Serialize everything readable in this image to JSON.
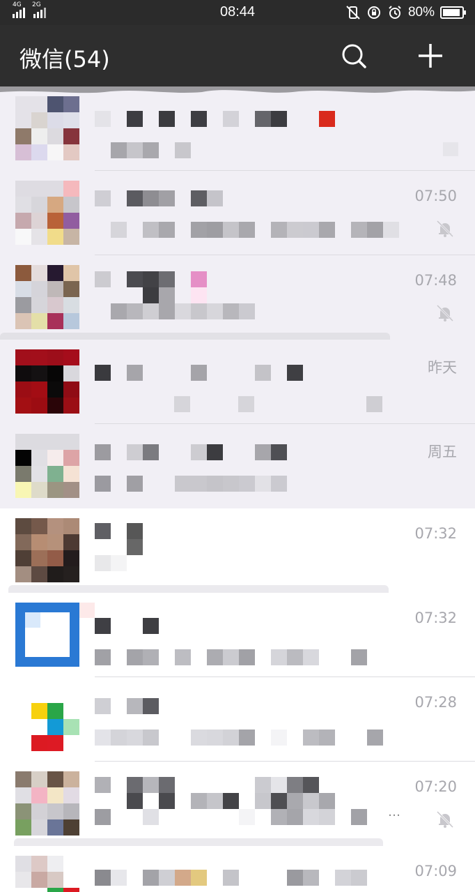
{
  "status_bar": {
    "net_left": "4G",
    "net_right": "2G",
    "time": "08:44",
    "battery": "80%",
    "icons": [
      "signal-icon",
      "vibrate-off-icon",
      "rotation-lock-icon",
      "alarm-icon",
      "battery-icon"
    ]
  },
  "header": {
    "title": "微信(54)",
    "search_icon": "search-icon",
    "add_icon": "plus-icon"
  },
  "chats": [
    {
      "time": "",
      "muted": false
    },
    {
      "time": "07:50",
      "muted": true
    },
    {
      "time": "07:48",
      "muted": true
    },
    {
      "time": "昨天",
      "muted": false
    },
    {
      "time": "周五",
      "muted": false
    },
    {
      "time": "07:32",
      "muted": false
    },
    {
      "time": "07:32",
      "muted": false
    },
    {
      "time": "07:28",
      "muted": false
    },
    {
      "time": "07:20",
      "muted": true,
      "preview_suffix": "…"
    },
    {
      "time": "07:09",
      "muted": false
    }
  ],
  "colors": {
    "header_bg": "#2e2e2e",
    "statusbar_bg": "#2b2b2b",
    "row_bg": "#f1eff5",
    "time_text": "#a7a7ad"
  }
}
